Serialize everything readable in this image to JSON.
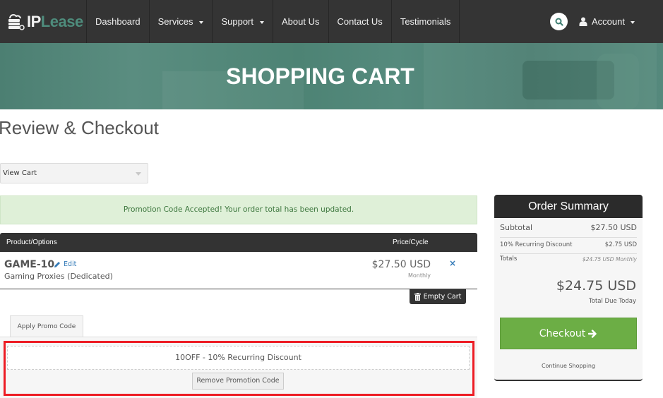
{
  "navbar": {
    "logo": {
      "part1": "IP",
      "part2": "Lease"
    },
    "items": [
      {
        "label": "Dashboard",
        "dropdown": false
      },
      {
        "label": "Services",
        "dropdown": true
      },
      {
        "label": "Support",
        "dropdown": true
      },
      {
        "label": "About Us",
        "dropdown": false
      },
      {
        "label": "Contact Us",
        "dropdown": false
      },
      {
        "label": "Testimonials",
        "dropdown": false
      }
    ],
    "search_icon": "search-icon",
    "account_label": "Account"
  },
  "hero": {
    "title": "SHOPPING CART"
  },
  "page": {
    "heading": "Review & Checkout",
    "view_select": {
      "selected": "View Cart"
    }
  },
  "alert": {
    "message": "Promotion Code Accepted! Your order total has been updated."
  },
  "cart": {
    "columns": [
      "Product/Options",
      "Price/Cycle"
    ],
    "items": [
      {
        "name": "GAME-10",
        "edit_label": "Edit",
        "group": "Gaming Proxies (Dedicated)",
        "price": "$27.50 USD",
        "cycle": "Monthly"
      }
    ],
    "remove_icon": "×",
    "empty_cart_label": "Empty Cart"
  },
  "promo": {
    "tab_label": "Apply Promo Code",
    "applied_text": "10OFF - 10% Recurring Discount",
    "remove_label": "Remove Promotion Code",
    "highlight_color": "#ed1c24"
  },
  "summary": {
    "title": "Order Summary",
    "rows": [
      {
        "label": "Subtotal",
        "value": "$27.50 USD"
      },
      {
        "label": "10% Recurring Discount",
        "value": "$2.75 USD"
      },
      {
        "label": "Totals",
        "value": "$24.75 USD Monthly"
      }
    ],
    "total_due": "$24.75 USD",
    "total_due_label": "Total Due Today",
    "checkout_label": "Checkout",
    "continue_label": "Continue Shopping",
    "checkout_color": "#6cae45"
  }
}
